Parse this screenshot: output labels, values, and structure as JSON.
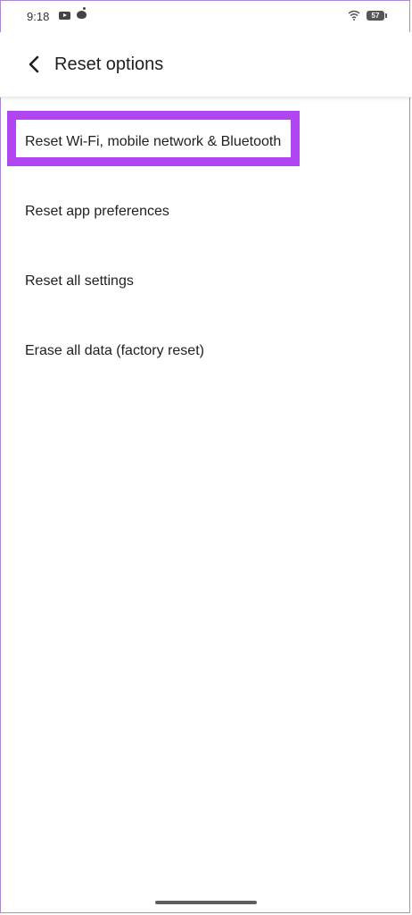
{
  "status_bar": {
    "time": "9:18",
    "battery": "57",
    "notification_icons": [
      "youtube-icon",
      "reddit-icon"
    ],
    "system_icons": [
      "wifi-icon",
      "battery-icon"
    ]
  },
  "header": {
    "title": "Reset options",
    "back_icon": "back-arrow-icon"
  },
  "reset_options": [
    {
      "label": "Reset Wi-Fi, mobile network & Bluetooth",
      "highlighted": true
    },
    {
      "label": "Reset app preferences",
      "highlighted": false
    },
    {
      "label": "Reset all settings",
      "highlighted": false
    },
    {
      "label": "Erase all data (factory reset)",
      "highlighted": false
    }
  ],
  "colors": {
    "highlight": "#b145f2",
    "background": "#ffffff",
    "text": "#1f1f1f"
  }
}
